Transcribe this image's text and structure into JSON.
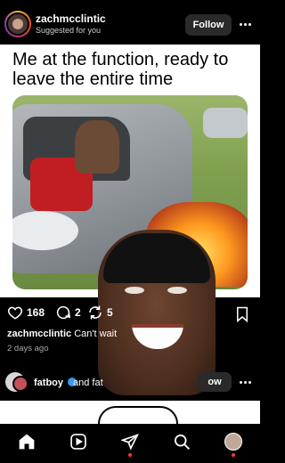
{
  "header": {
    "username": "zachmcclintic",
    "subtitle": "Suggested for you",
    "follow_label": "Follow"
  },
  "post": {
    "caption_text": "Me at the function, ready to leave the entire time"
  },
  "actions": {
    "like_count": "168",
    "comment_count": "2",
    "repost_count": "5"
  },
  "caption": {
    "username": "zachmcclintic",
    "text": "Can't wait"
  },
  "timestamp": "2 days ago",
  "suggestion": {
    "name": "fatboy",
    "and_text": "and fat",
    "follow_label": "ow"
  },
  "nav": {
    "items": [
      "home-icon",
      "reels-icon",
      "send-icon",
      "search-icon",
      "profile-icon"
    ]
  },
  "colors": {
    "background": "#000000",
    "follow_button": "#2a2a2a",
    "verified": "#3897f0",
    "notification_dot": "#ff3040"
  }
}
